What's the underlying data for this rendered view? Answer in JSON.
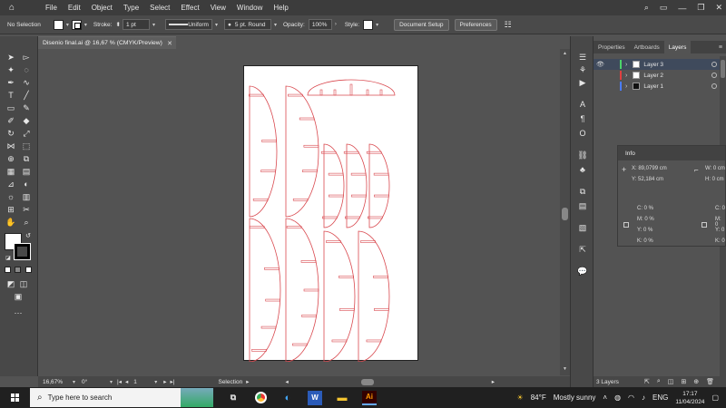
{
  "menubar": {
    "items": [
      "File",
      "Edit",
      "Object",
      "Type",
      "Select",
      "Effect",
      "View",
      "Window",
      "Help"
    ]
  },
  "controlbar": {
    "selection_label": "No Selection",
    "stroke_label": "Stroke:",
    "stroke_value": "1 pt",
    "profile": "Uniform",
    "brush": "5 pt. Round",
    "opacity_label": "Opacity:",
    "opacity_value": "100%",
    "style_label": "Style:",
    "document_setup": "Document Setup",
    "preferences": "Preferences"
  },
  "document": {
    "tab_title": "Disenio final.ai @ 16,67 % (CMYK/Preview)"
  },
  "statusbar": {
    "zoom": "16,67%",
    "rotation": "0°",
    "artboard_number": "1",
    "tool": "Selection"
  },
  "panel": {
    "tabs": [
      "Properties",
      "Artboards",
      "Layers"
    ],
    "active_tab": "Layers",
    "layers": [
      {
        "name": "Layer 3",
        "color": "#4cd46a"
      },
      {
        "name": "Layer 2",
        "color": "#e04040"
      },
      {
        "name": "Layer 1",
        "color": "#4a7cff"
      }
    ],
    "layer_count": "3 Layers"
  },
  "info": {
    "title": "Info",
    "x": "X: 89,0799 cm",
    "y": "Y: 52,184 cm",
    "w": "W: 0 cm",
    "h": "H: 0 cm",
    "c": "C: 0 %",
    "m": "M: 0 %",
    "yy": "Y: 0 %",
    "k": "K: 0 %",
    "c2": "C: 0",
    "m2": "M: 0",
    "y2": "Y: 0",
    "k2": "K: 0"
  },
  "taskbar": {
    "search_placeholder": "Type here to search",
    "temperature": "84°F",
    "weather": "Mostly sunny",
    "language": "ENG",
    "time": "17:17",
    "date": "11/04/2024"
  },
  "colors": {
    "cut_line": "#d9494f",
    "accent": "#4a7cff"
  }
}
